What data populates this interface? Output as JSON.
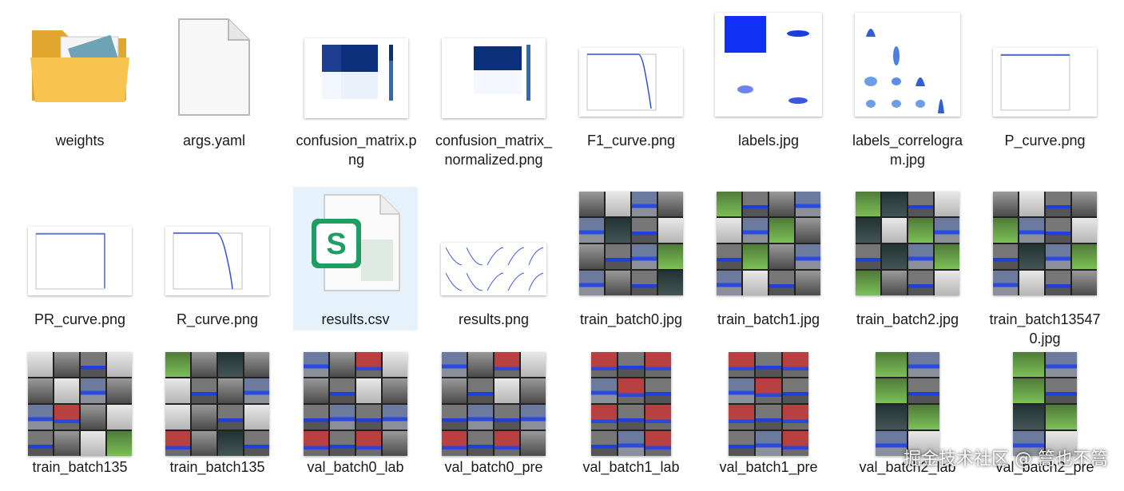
{
  "files": [
    {
      "name": "weights",
      "type": "folder"
    },
    {
      "name": "args.yaml",
      "type": "file"
    },
    {
      "name": "confusion_matrix.png",
      "type": "image"
    },
    {
      "name": "confusion_matrix_normalized.png",
      "type": "image"
    },
    {
      "name": "F1_curve.png",
      "type": "image"
    },
    {
      "name": "labels.jpg",
      "type": "image"
    },
    {
      "name": "labels_correlogram.jpg",
      "type": "image"
    },
    {
      "name": "P_curve.png",
      "type": "image"
    },
    {
      "name": "PR_curve.png",
      "type": "image"
    },
    {
      "name": "R_curve.png",
      "type": "image"
    },
    {
      "name": "results.csv",
      "type": "spreadsheet",
      "selected": true
    },
    {
      "name": "results.png",
      "type": "image"
    },
    {
      "name": "train_batch0.jpg",
      "type": "image"
    },
    {
      "name": "train_batch1.jpg",
      "type": "image"
    },
    {
      "name": "train_batch2.jpg",
      "type": "image"
    },
    {
      "name": "train_batch135470.jpg",
      "type": "image"
    },
    {
      "name": "train_batch135",
      "type": "image"
    },
    {
      "name": "train_batch135",
      "type": "image"
    },
    {
      "name": "val_batch0_lab",
      "type": "image"
    },
    {
      "name": "val_batch0_pre",
      "type": "image"
    },
    {
      "name": "val_batch1_lab",
      "type": "image"
    },
    {
      "name": "val_batch1_pre",
      "type": "image"
    },
    {
      "name": "val_batch2_lab",
      "type": "image"
    },
    {
      "name": "val_batch2_pre",
      "type": "image"
    }
  ],
  "watermark": "掘金技术社区 @ 篙也不篙",
  "colors": {
    "selection": "#e5f1fb",
    "folder": "#f5c24c",
    "accent_blue": "#1e3fd8",
    "csv_green": "#1f9d62"
  }
}
